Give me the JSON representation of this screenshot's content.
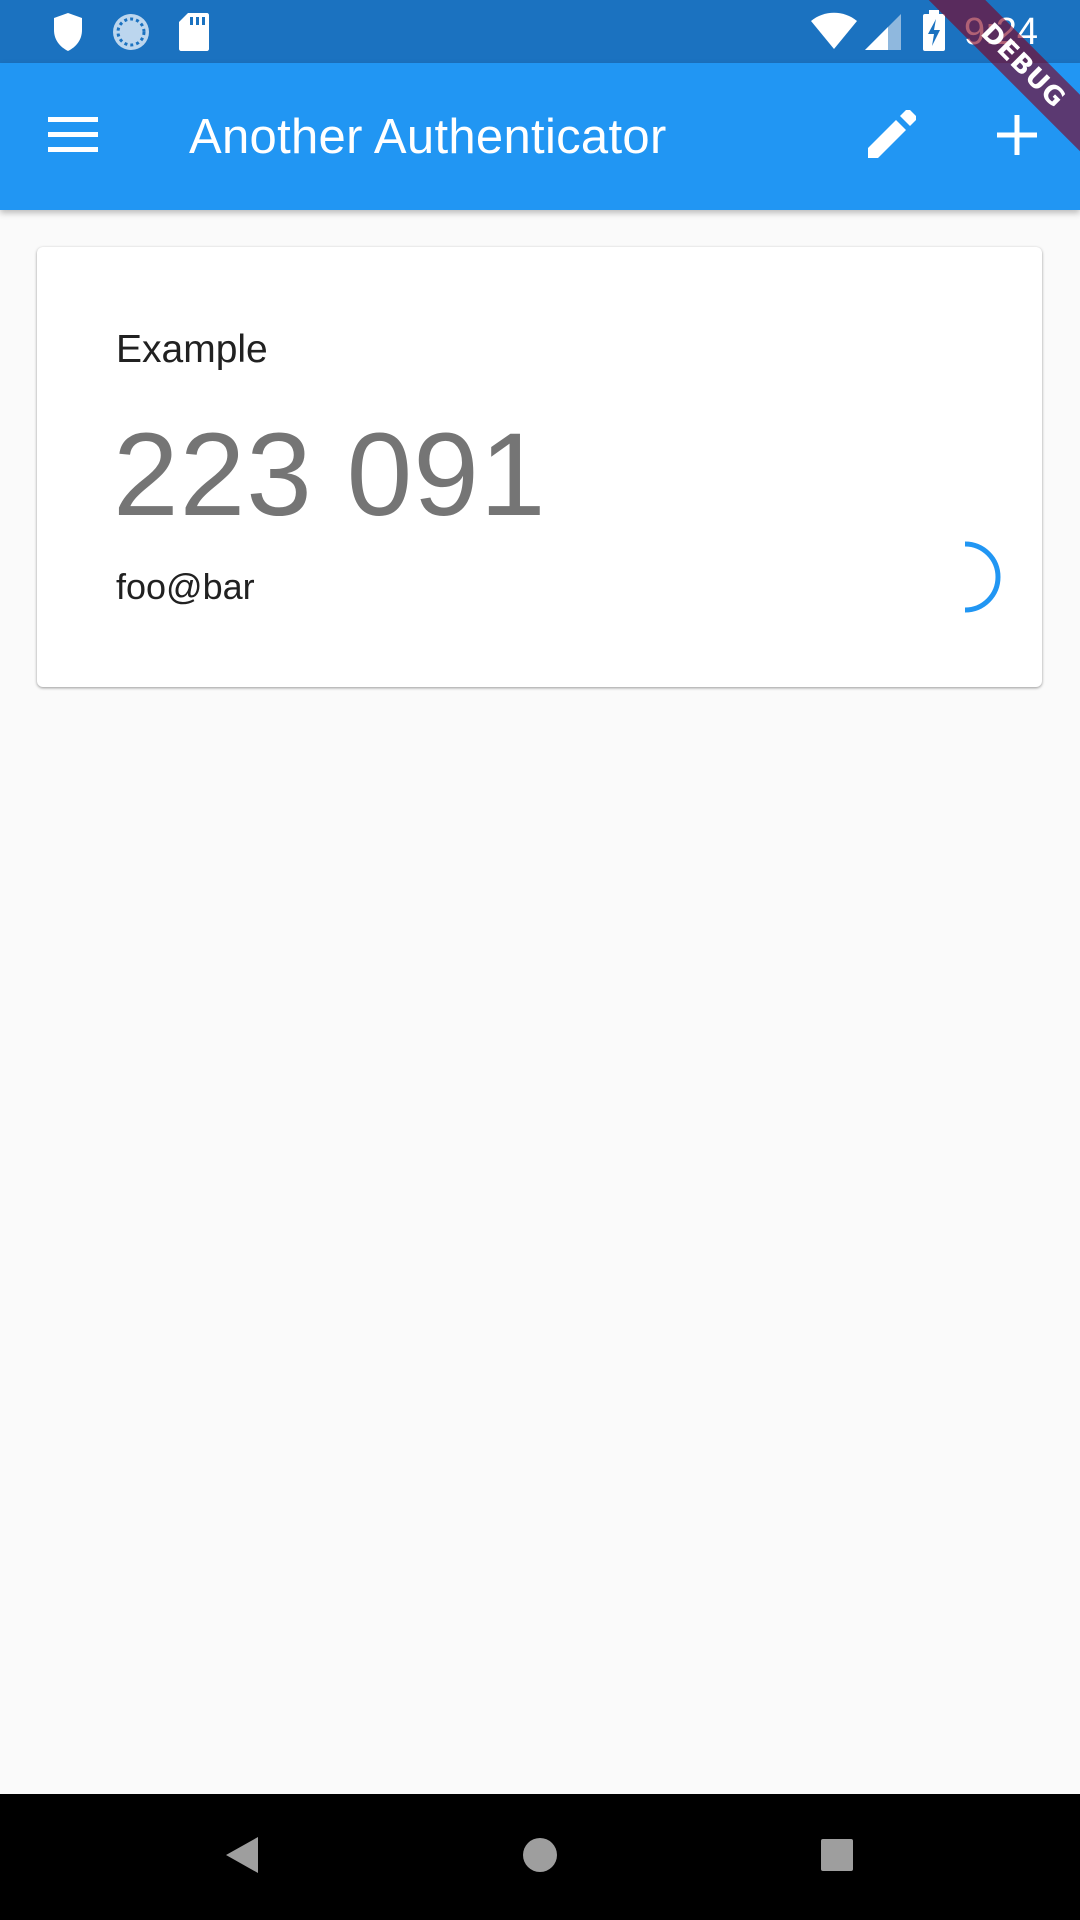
{
  "status_bar": {
    "time": "9:24",
    "icons": [
      "shield-icon",
      "sync-circle-icon",
      "sd-card-icon",
      "wifi-icon",
      "cellular-signal-icon",
      "battery-charging-icon"
    ]
  },
  "app_bar": {
    "title": "Another Authenticator",
    "menu_icon": "menu-icon",
    "edit_icon": "edit-icon",
    "add_icon": "add-icon",
    "color": "#2196f3"
  },
  "debug_banner": {
    "label": "DEBUG"
  },
  "accounts": [
    {
      "issuer": "Example",
      "code": "223 091",
      "account": "foo@bar",
      "accent_color": "#2196f3"
    }
  ],
  "nav_bar": {
    "icons": [
      "back-icon",
      "home-icon",
      "recents-icon"
    ]
  }
}
